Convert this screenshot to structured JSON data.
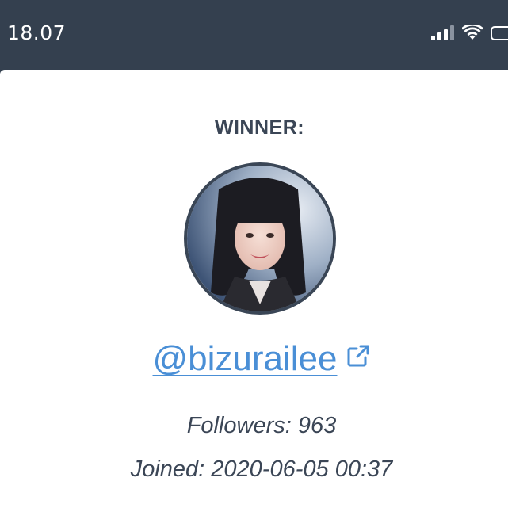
{
  "status_bar": {
    "time": "18.07",
    "icons": [
      "signal-icon",
      "wifi-icon",
      "battery-icon"
    ]
  },
  "winner": {
    "label": "WINNER:",
    "username": "@bizurailee",
    "followers": "Followers: 963",
    "joined": "Joined: 2020-06-05 00:37"
  },
  "colors": {
    "header_bg": "#34404f",
    "text_dark": "#3b4656",
    "link": "#4a8fd6",
    "avatar_border": "#3a4656"
  }
}
